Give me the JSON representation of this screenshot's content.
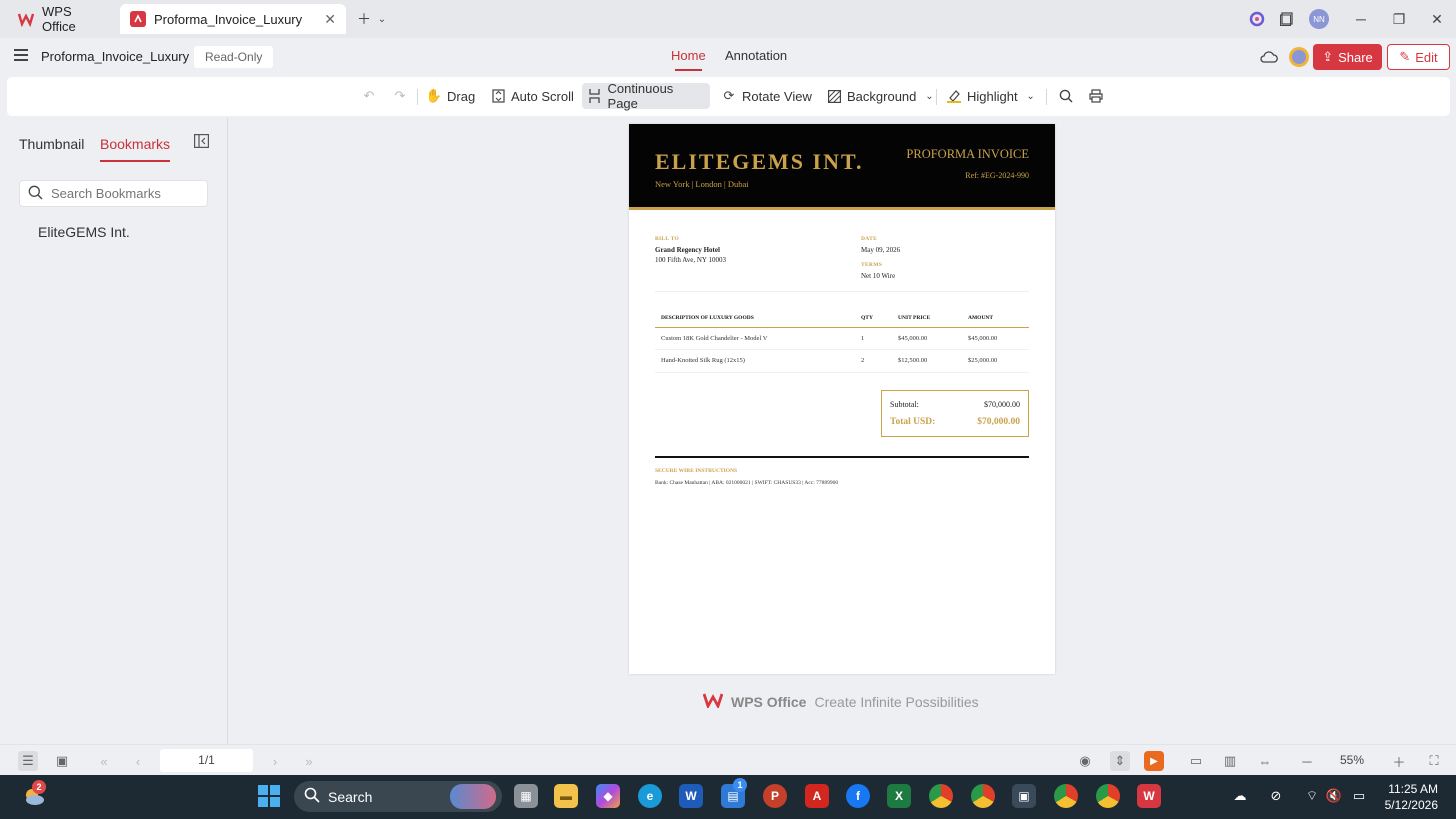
{
  "tabs": {
    "wps_office": "WPS Office",
    "document": "Proforma_Invoice_Luxury"
  },
  "header": {
    "doc_title": "Proforma_Invoice_Luxury",
    "readonly": "Read-Only",
    "tab_home": "Home",
    "tab_annotation": "Annotation",
    "share": "Share",
    "edit": "Edit",
    "avatar_initials": "NN"
  },
  "toolbar": {
    "drag": "Drag",
    "auto_scroll": "Auto Scroll",
    "continuous_page": "Continuous Page",
    "rotate_view": "Rotate View",
    "background": "Background",
    "highlight": "Highlight"
  },
  "panel": {
    "thumbnail": "Thumbnail",
    "bookmarks": "Bookmarks",
    "search_placeholder": "Search Bookmarks",
    "bookmark_item": "EliteGEMS Int."
  },
  "invoice": {
    "company": "ELITEGEMS INT.",
    "locations": "New York | London | Dubai",
    "title": "PROFORMA INVOICE",
    "ref": "Ref: #EG-2024-990",
    "bill_to_label": "BILL TO",
    "bill_to_name": "Grand Regency Hotel",
    "bill_to_address": "100 Fifth Ave, NY 10003",
    "date_label": "DATE",
    "date_value": "May 09, 2026",
    "terms_label": "TERMS",
    "terms_value": "Net 10 Wire",
    "columns": [
      "DESCRIPTION OF LUXURY GOODS",
      "QTY",
      "UNIT PRICE",
      "AMOUNT"
    ],
    "rows": [
      [
        "Custom 18K Gold Chandelier - Model V",
        "1",
        "$45,000.00",
        "$45,000.00"
      ],
      [
        "Hand-Knotted Silk Rug (12x15)",
        "2",
        "$12,500.00",
        "$25,000.00"
      ]
    ],
    "subtotal_label": "Subtotal:",
    "subtotal_value": "$70,000.00",
    "total_label": "Total USD:",
    "total_value": "$70,000.00",
    "wire_label": "SECURE WIRE INSTRUCTIONS",
    "wire_value": "Bank: Chase Manhattan | ABA: 021000021 | SWIFT: CHASUS33 | Acc: 77889900"
  },
  "brand": {
    "name": "WPS Office",
    "tagline": "Create Infinite Possibilities"
  },
  "status": {
    "page": "1/1",
    "zoom": "55%"
  },
  "taskbar": {
    "search": "Search",
    "time": "11:25 AM",
    "date": "5/12/2026",
    "weather_badge": "2",
    "store_badge": "1"
  },
  "colors": {
    "accent_red": "#d73741",
    "gold": "#c9a24a",
    "header_black": "#040404"
  }
}
